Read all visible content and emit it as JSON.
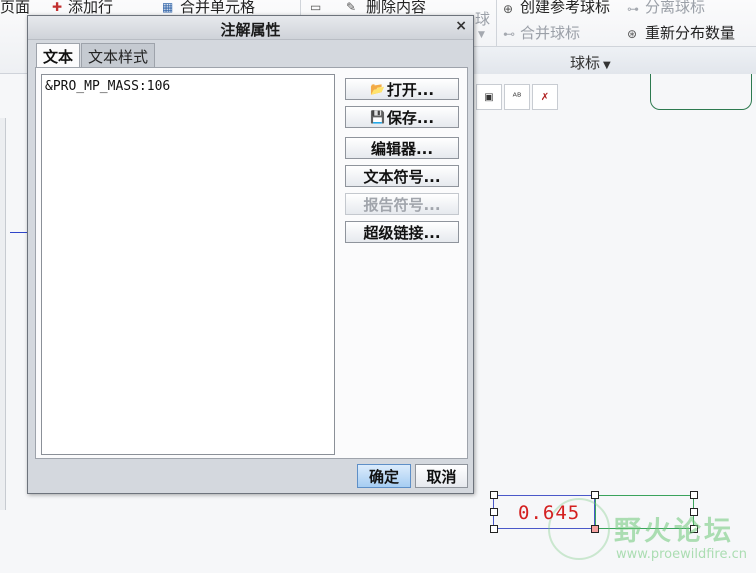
{
  "ribbon": {
    "item_page": "页面",
    "item_add_row": "添加行",
    "item_merge_cells": "合并单元格",
    "item_delete_content": "删除内容",
    "item_balloon_partial": "球",
    "item_create_ref_balloon": "创建参考球标",
    "item_separate_balloon": "分离球标",
    "item_merge_balloon": "合并球标",
    "item_renumber": "重新分布数量",
    "group_label": "球标"
  },
  "dialog": {
    "title": "注解属性",
    "close_symbol": "×",
    "tabs": [
      "文本",
      "文本样式"
    ],
    "text_content": "&PRO_MP_MASS:106",
    "buttons": {
      "open": "打开...",
      "save": "保存...",
      "editor": "编辑器...",
      "text_symbol": "文本符号...",
      "report_symbol": "报告符号...",
      "hyperlink": "超级链接..."
    },
    "ok": "确定",
    "cancel": "取消"
  },
  "drawing": {
    "dimension_value": "0.645"
  },
  "watermark": {
    "title": "野火论坛",
    "url": "www.proewildfire.cn"
  },
  "colors": {
    "dimension_text": "#d42020",
    "selection_box": "#4a58c9",
    "ok_button": "#a6cdf2"
  }
}
